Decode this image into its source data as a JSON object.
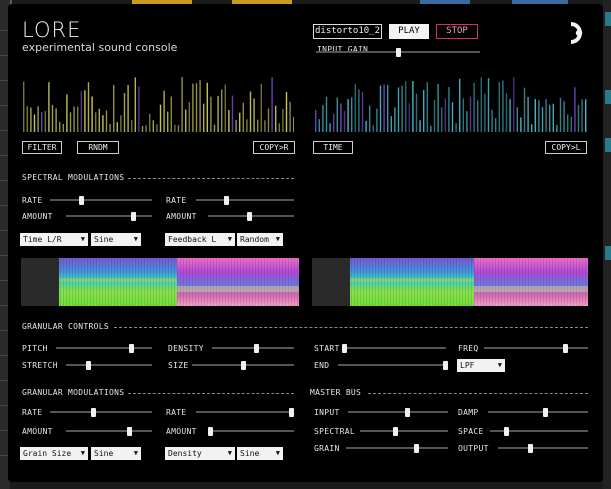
{
  "app": {
    "title": "LORE",
    "subtitle": "experimental sound console"
  },
  "transport": {
    "sample_name": "distorto10_2",
    "play_label": "PLAY",
    "stop_label": "STOP",
    "input_gain_label": "INPUT GAIN",
    "input_gain_value": 0.5
  },
  "waveform": {
    "left_color": "#c8c85a",
    "right_color": "#46b8c8",
    "filter_label": "FILTER",
    "rndm_label": "RNDM",
    "copy_r_label": "COPY>R",
    "time_label": "TIME",
    "copy_l_label": "COPY>L"
  },
  "spectral_mod": {
    "title": "SPECTRAL MODULATIONS",
    "left": {
      "rate_label": "RATE",
      "rate": 0.3,
      "amount_label": "AMOUNT",
      "amount": 0.8,
      "target": "Time L/R",
      "shape": "Sine"
    },
    "right": {
      "rate_label": "RATE",
      "rate": 0.3,
      "amount_label": "AMOUNT",
      "amount": 0.48,
      "target": "Feedback L",
      "shape": "Random"
    }
  },
  "granular_controls": {
    "title": "GRANULAR CONTROLS",
    "pitch_label": "PITCH",
    "pitch": 0.8,
    "density_label": "DENSITY",
    "density": 0.55,
    "stretch_label": "STRETCH",
    "stretch": 0.25,
    "size_label": "SIZE",
    "size": 0.5,
    "start_label": "START",
    "start": 0.0,
    "freq_label": "FREQ",
    "freq": 0.8,
    "end_label": "END",
    "end": 1.0,
    "filter_type": "LPF"
  },
  "granular_mod": {
    "title": "GRANULAR MODULATIONS",
    "left": {
      "rate_label": "RATE",
      "rate": 0.42,
      "amount_label": "AMOUNT",
      "amount": 0.75,
      "target": "Grain Size",
      "shape": "Sine"
    },
    "right": {
      "rate_label": "RATE",
      "rate": 1.0,
      "amount_label": "AMOUNT",
      "amount": 0.0,
      "target": "Density",
      "shape": "Sine"
    }
  },
  "master_bus": {
    "title": "MASTER BUS",
    "input_label": "INPUT",
    "input": 0.6,
    "spectral_label": "SPECTRAL",
    "spectral": 0.4,
    "grain_label": "GRAIN",
    "grain": 0.7,
    "damp_label": "DAMP",
    "damp": 0.58,
    "space_label": "SPACE",
    "space": 0.15,
    "output_label": "OUTPUT",
    "output": 0.35
  },
  "icons": {
    "logo": "lore-logo-icon",
    "dropdown": "chevron-down-icon"
  }
}
